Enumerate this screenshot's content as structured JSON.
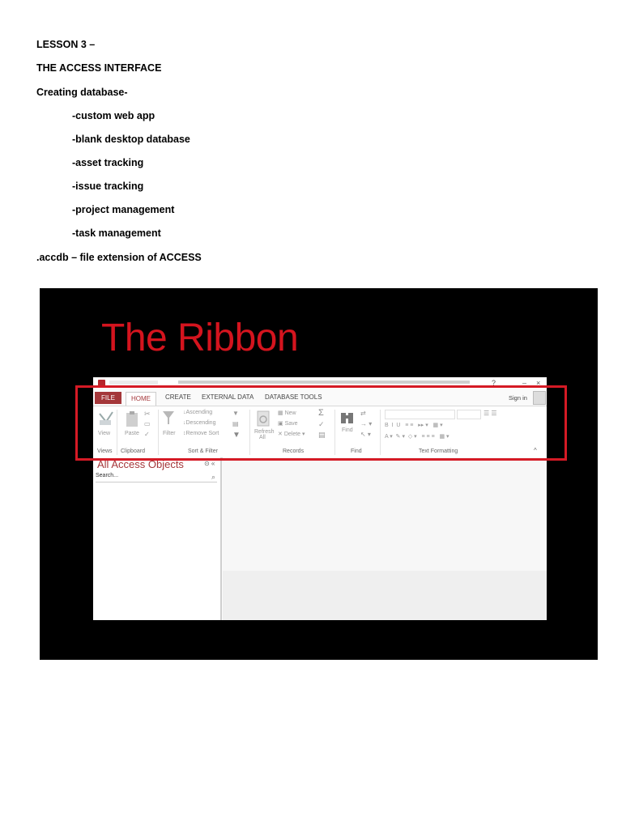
{
  "document": {
    "lesson": "LESSON 3 –",
    "heading": "THE ACCESS INTERFACE",
    "intro": "Creating database-",
    "items": [
      "-custom web app",
      "-blank desktop database",
      "-asset tracking",
      "-issue tracking",
      "-project management",
      "-task management"
    ],
    "footer_note": ".accdb – file extension of ACCESS"
  },
  "slide": {
    "title": "The Ribbon",
    "title_color": "#d4141e",
    "highlight_color": "#d51a25",
    "app": {
      "tabs": {
        "file": "FILE",
        "home": "HOME",
        "create": "CREATE",
        "external": "EXTERNAL DATA",
        "dbtools": "DATABASE TOOLS"
      },
      "sign_in": "Sign in",
      "ribbon": {
        "view": "View",
        "paste": "Paste",
        "filter": "Filter",
        "ascending": "Ascending",
        "descending": "Descending",
        "remove_sort": "Remove Sort",
        "refresh": "Refresh",
        "refresh_all": "All",
        "new": "New",
        "save": "Save",
        "delete": "Delete",
        "find": "Find",
        "groups": {
          "views": "Views",
          "clipboard": "Clipboard",
          "sort_filter": "Sort & Filter",
          "records": "Records",
          "find": "Find",
          "text_formatting": "Text Formatting"
        }
      },
      "nav_pane": {
        "title": "All Access Objects",
        "search_placeholder": "Search..."
      }
    }
  }
}
